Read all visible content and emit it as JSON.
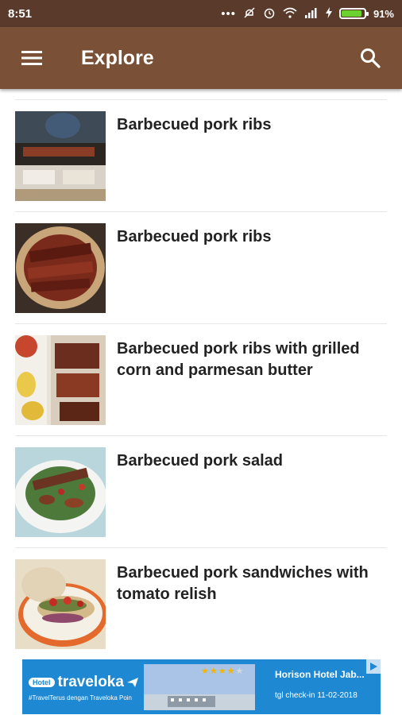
{
  "status_bar": {
    "time": "8:51",
    "battery": "91%",
    "battery_level": 0.91,
    "icons": [
      "more-dots-icon",
      "mute-icon",
      "alarm-icon",
      "wifi-icon",
      "signal-icon",
      "charging-icon",
      "battery-icon"
    ]
  },
  "app_bar": {
    "title": "Explore",
    "menu_icon": "hamburger-menu-icon",
    "search_icon": "search-icon",
    "background": "#7a5036",
    "status_background": "#5a3a2a"
  },
  "recipes": [
    {
      "title": "Barbecued pork ribs",
      "image": "bbq-grill-photo"
    },
    {
      "title": "Barbecued pork ribs",
      "image": "ribs-on-parchment-photo"
    },
    {
      "title": "Barbecued pork ribs with grilled corn and parmesan butter",
      "image": "ribs-and-corn-photo"
    },
    {
      "title": "Barbecued pork salad",
      "image": "pork-salad-photo"
    },
    {
      "title": "Barbecued pork sandwiches with tomato relish",
      "image": "pork-sandwich-photo"
    }
  ],
  "ad": {
    "label": "Hotel",
    "brand": "traveloka",
    "tagline": "#TravelTerus dengan Traveloka Poin",
    "hotel": "Horison Hotel Jab...",
    "checkin": "tgl check-in 11-02-2018",
    "rating": 4,
    "background": "#1e88d2"
  }
}
